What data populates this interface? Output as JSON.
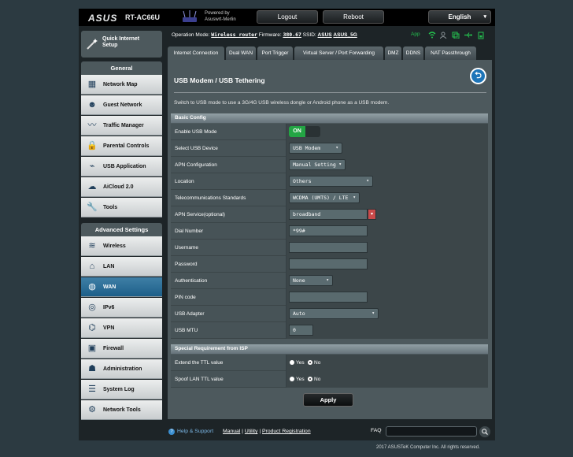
{
  "header": {
    "brand": "ASUS",
    "model": "RT-AC66U",
    "powered_by_line1": "Powered by",
    "powered_by_line2": "Asuswrt-Merlin",
    "logout_label": "Logout",
    "reboot_label": "Reboot",
    "language": "English"
  },
  "nav": {
    "quick_setup_line1": "Quick Internet",
    "quick_setup_line2": "Setup",
    "general_title": "General",
    "general_items": [
      {
        "label": "Network Map",
        "icon": "network-map-icon"
      },
      {
        "label": "Guest Network",
        "icon": "guest-network-icon"
      },
      {
        "label": "Traffic Manager",
        "icon": "traffic-manager-icon"
      },
      {
        "label": "Parental Controls",
        "icon": "parental-controls-icon"
      },
      {
        "label": "USB Application",
        "icon": "usb-icon"
      },
      {
        "label": "AiCloud 2.0",
        "icon": "cloud-icon"
      },
      {
        "label": "Tools",
        "icon": "wrench-icon"
      }
    ],
    "advanced_title": "Advanced Settings",
    "advanced_items": [
      {
        "label": "Wireless",
        "icon": "wifi-icon"
      },
      {
        "label": "LAN",
        "icon": "home-icon"
      },
      {
        "label": "WAN",
        "icon": "globe-icon",
        "active": true
      },
      {
        "label": "IPv6",
        "icon": "ipv6-icon"
      },
      {
        "label": "VPN",
        "icon": "vpn-icon"
      },
      {
        "label": "Firewall",
        "icon": "firewall-icon"
      },
      {
        "label": "Administration",
        "icon": "admin-icon"
      },
      {
        "label": "System Log",
        "icon": "system-log-icon"
      },
      {
        "label": "Network Tools",
        "icon": "network-tools-icon"
      }
    ]
  },
  "status": {
    "op_mode_label": "Operation Mode:",
    "op_mode_value": "Wireless router",
    "firmware_label": "Firmware:",
    "firmware_value": "380.67",
    "ssid_label": "SSID:",
    "ssid1": "ASUS",
    "ssid2": "ASUS_5G",
    "app_label": "App"
  },
  "tabs": [
    "Internet Connection",
    "Dual WAN",
    "Port Trigger",
    "Virtual Server / Port Forwarding",
    "DMZ",
    "DDNS",
    "NAT Passthrough"
  ],
  "page": {
    "title": "USB Modem / USB Tethering",
    "description": "Switch to USB mode to use a 3G/4G USB wireless dongle or Android phone as a USB modem.",
    "basic_config_title": "Basic Config",
    "enable_usb_mode_label": "Enable USB Mode",
    "enable_usb_mode_value": "ON",
    "select_usb_device_label": "Select USB Device",
    "select_usb_device_value": "USB Modem",
    "apn_config_label": "APN Configuration",
    "apn_config_value": "Manual Setting",
    "location_label": "Location",
    "location_value": "Others",
    "telecom_label": "Telecommunications Standards",
    "telecom_value": "WCDMA (UMTS) / LTE",
    "apn_service_label": "APN Service(optional)",
    "apn_service_value": "broadband",
    "dial_number_label": "Dial Number",
    "dial_number_value": "*99#",
    "username_label": "Username",
    "username_value": "",
    "password_label": "Password",
    "password_value": "",
    "auth_label": "Authentication",
    "auth_value": "None",
    "pin_label": "PIN code",
    "pin_value": "",
    "usb_adapter_label": "USB Adapter",
    "usb_adapter_value": "Auto",
    "usb_mtu_label": "USB MTU",
    "usb_mtu_value": "0",
    "isp_title": "Special Requirement from ISP",
    "extend_ttl_label": "Extend the TTL value",
    "spoof_ttl_label": "Spoof LAN TTL value",
    "yes_label": "Yes",
    "no_label": "No",
    "apply_label": "Apply"
  },
  "footer": {
    "help_label": "Help & Support",
    "manual": "Manual",
    "utility": "Utility",
    "product_registration": "Product Registration",
    "faq_label": "FAQ",
    "copyright": "2017 ASUSTeK Computer Inc. All rights reserved."
  }
}
